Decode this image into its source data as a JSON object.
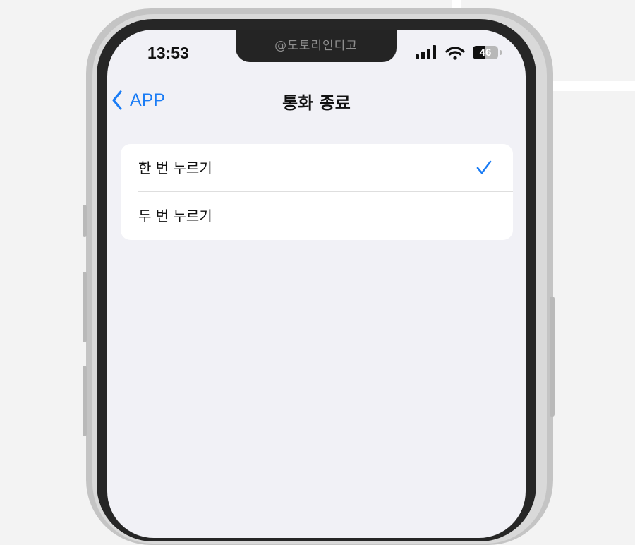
{
  "status_bar": {
    "time": "13:53",
    "battery_level": "46",
    "battery_fraction": 0.46,
    "icons": [
      "signal-icon",
      "wifi-icon",
      "battery-icon"
    ]
  },
  "notch": {
    "watermark": "@도토리인디고"
  },
  "navigation": {
    "back_label": "APP",
    "back_icon": "chevron-left-icon",
    "title": "통화 종료"
  },
  "options": [
    {
      "label": "한 번 누르기",
      "selected": true
    },
    {
      "label": "두 번 누르기",
      "selected": false
    }
  ],
  "colors": {
    "accent": "#1a7cf5",
    "screen_background": "#f1f1f6",
    "group_background": "#ffffff"
  }
}
